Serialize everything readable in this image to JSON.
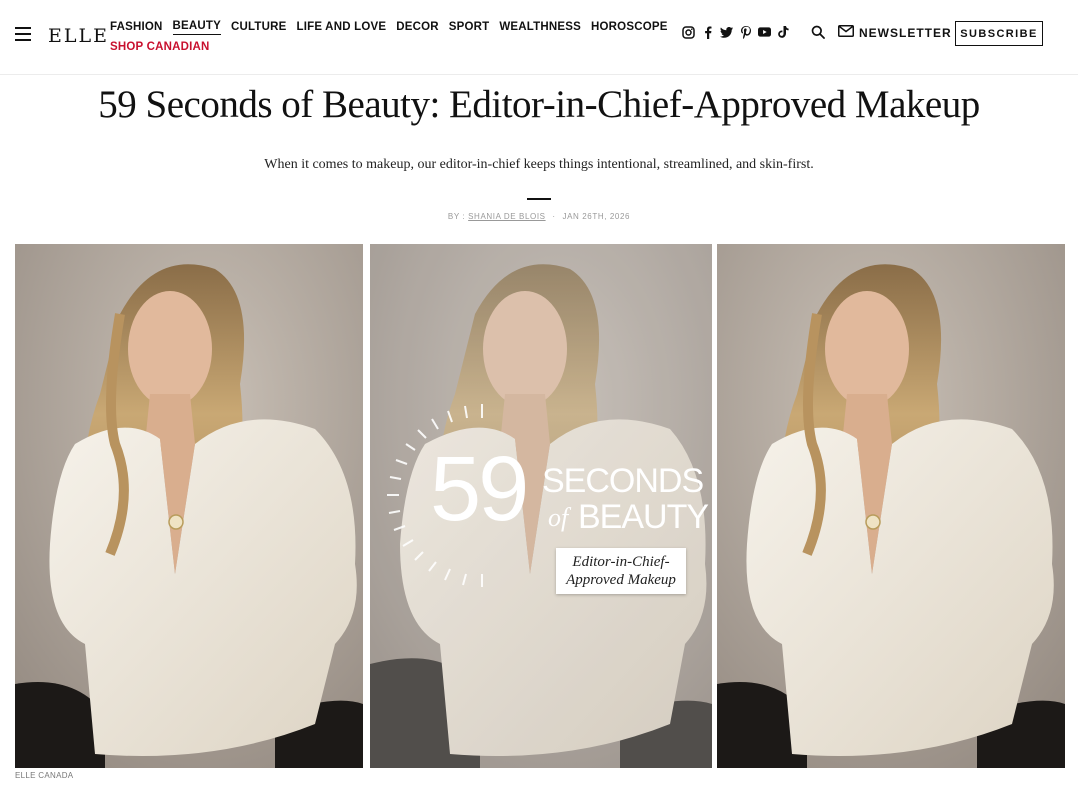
{
  "brand": {
    "logo": "ELLE"
  },
  "nav": {
    "items": [
      {
        "label": "FASHION"
      },
      {
        "label": "BEAUTY"
      },
      {
        "label": "CULTURE"
      },
      {
        "label": "LIFE AND LOVE"
      },
      {
        "label": "DECOR"
      },
      {
        "label": "SPORT"
      },
      {
        "label": "WEALTHNESS"
      },
      {
        "label": "HOROSCOPE"
      }
    ],
    "shop": {
      "label": "SHOP CANADIAN"
    }
  },
  "social_icons": [
    "instagram-icon",
    "facebook-icon",
    "twitter-icon",
    "pinterest-icon",
    "youtube-icon",
    "tiktok-icon"
  ],
  "header": {
    "newsletter_label": "NEWSLETTER",
    "subscribe_label": "SUBSCRIBE"
  },
  "article": {
    "title": "59 Seconds of Beauty: Editor-in-Chief-Approved Makeup",
    "dek": "When it comes to makeup, our editor-in-chief keeps things intentional, streamlined, and skin-first.",
    "byline_prefix": "BY :",
    "author": "SHANIA DE BLOIS",
    "date": "JAN 26TH, 2026",
    "photo_credit": "ELLE CANADA"
  },
  "hero_overlay": {
    "number": "59",
    "line1": "SECONDS",
    "line2_of": "of",
    "line2": "BEAUTY",
    "tag_line1": "Editor-in-Chief-",
    "tag_line2": "Approved Makeup"
  },
  "colors": {
    "accent_red": "#c8102e",
    "text": "#111111",
    "muted": "#999999",
    "backdrop": "#b3aaa1",
    "shirt": "#efe9de"
  }
}
